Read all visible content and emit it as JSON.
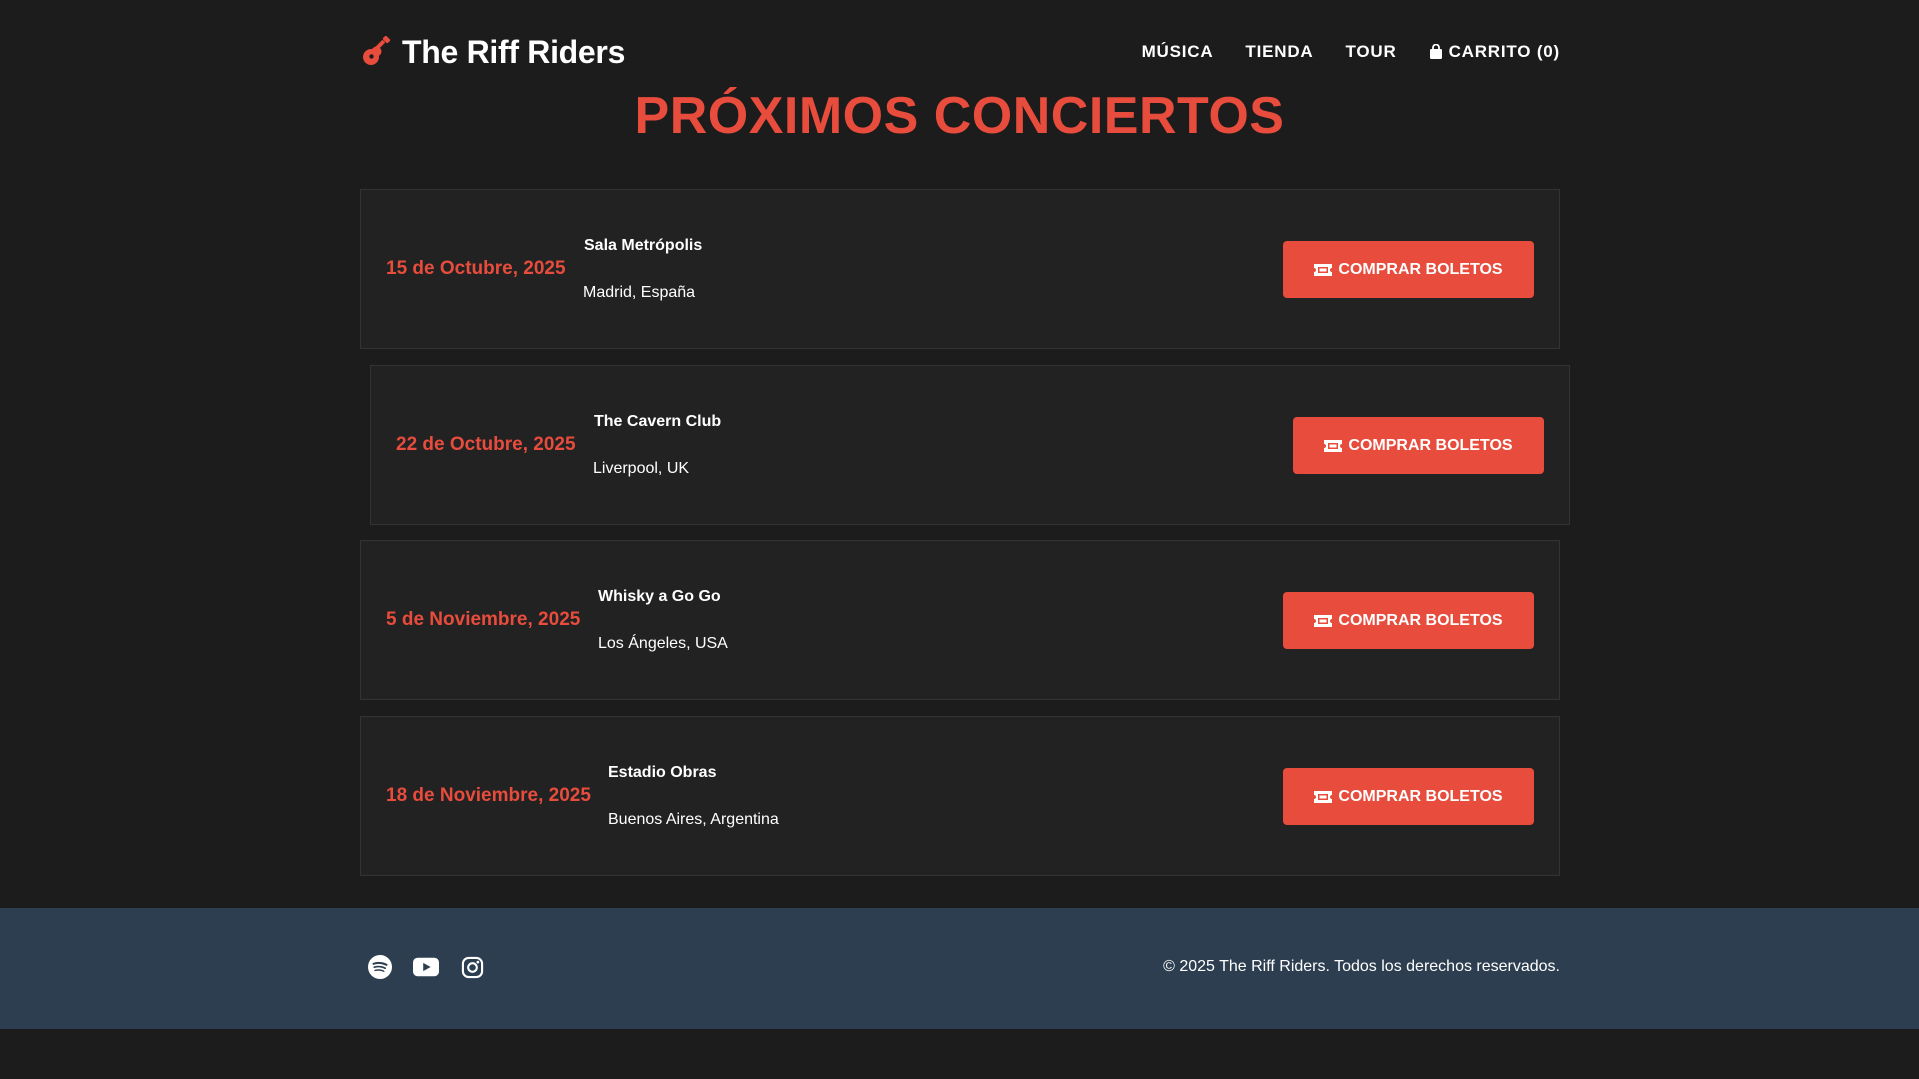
{
  "header": {
    "brand": "The Riff Riders",
    "nav": {
      "music": "MÚSICA",
      "shop": "TIENDA",
      "tour": "TOUR",
      "cart": "CARRITO (0)"
    }
  },
  "main": {
    "title": "PRÓXIMOS CONCIERTOS",
    "buy_label": "COMPRAR BOLETOS",
    "concerts": [
      {
        "date": "15 de Octubre, 2025",
        "venue": "Sala Metrópolis",
        "city": "Madrid, España"
      },
      {
        "date": "22 de Octubre, 2025",
        "venue": "The Cavern Club",
        "city": "Liverpool, UK"
      },
      {
        "date": "5 de Noviembre, 2025",
        "venue": "Whisky a Go Go",
        "city": "Los Ángeles, USA"
      },
      {
        "date": "18 de Noviembre, 2025",
        "venue": "Estadio Obras",
        "city": "Buenos Aires, Argentina"
      }
    ]
  },
  "footer": {
    "copyright": "© 2025 The Riff Riders. Todos los derechos reservados.",
    "socials": [
      "spotify-icon",
      "youtube-icon",
      "instagram-icon"
    ]
  },
  "colors": {
    "accent": "#e74c3c",
    "background": "#1c1c1c",
    "card": "#222222",
    "footer": "#2c3e50"
  }
}
